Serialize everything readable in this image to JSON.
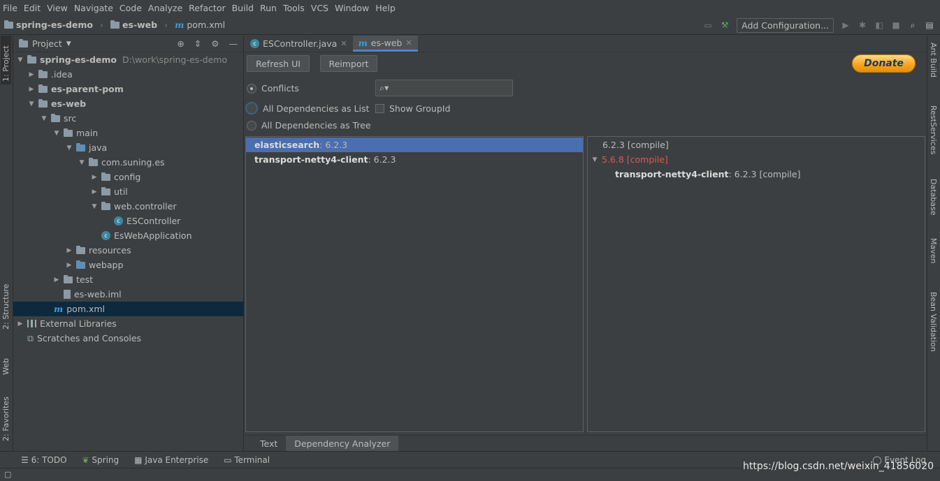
{
  "menu": [
    "File",
    "Edit",
    "View",
    "Navigate",
    "Code",
    "Analyze",
    "Refactor",
    "Build",
    "Run",
    "Tools",
    "VCS",
    "Window",
    "Help"
  ],
  "breadcrumb": {
    "project": "spring-es-demo",
    "module": "es-web",
    "file": "pom.xml"
  },
  "toolbar": {
    "add_config": "Add Configuration..."
  },
  "left_stripe": {
    "project": "1: Project",
    "structure": "2: Structure",
    "web": "Web",
    "favorites": "2: Favorites"
  },
  "right_stripe": {
    "ant": "Ant Build",
    "rest": "RestServices",
    "db": "Database",
    "maven": "Maven",
    "bean": "Bean Validation"
  },
  "project_panel": {
    "title": "Project",
    "root_path": "D:\\work\\spring-es-demo",
    "items": [
      {
        "label": "spring-es-demo",
        "bold": true
      },
      {
        "label": ".idea"
      },
      {
        "label": "es-parent-pom",
        "bold": true
      },
      {
        "label": "es-web",
        "bold": true
      },
      {
        "label": "src"
      },
      {
        "label": "main"
      },
      {
        "label": "java"
      },
      {
        "label": "com.suning.es"
      },
      {
        "label": "config"
      },
      {
        "label": "util"
      },
      {
        "label": "web.controller"
      },
      {
        "label": "ESController"
      },
      {
        "label": "EsWebApplication"
      },
      {
        "label": "resources"
      },
      {
        "label": "webapp"
      },
      {
        "label": "test"
      },
      {
        "label": "es-web.iml"
      },
      {
        "label": "pom.xml"
      },
      {
        "label": "External Libraries"
      },
      {
        "label": "Scratches and Consoles"
      }
    ]
  },
  "editor_tabs": [
    {
      "label": "ESController.java"
    },
    {
      "label": "es-web"
    }
  ],
  "analyzer": {
    "refresh": "Refresh UI",
    "reimport": "Reimport",
    "donate": "Donate",
    "conflicts": "Conflicts",
    "all_list": "All Dependencies as List",
    "all_tree": "All Dependencies as Tree",
    "show_group": "Show GroupId",
    "left_rows": [
      {
        "name": "elasticsearch",
        "ver": " : 6.2.3"
      },
      {
        "name": "transport-netty4-client",
        "ver": " : 6.2.3"
      }
    ],
    "right_rows": {
      "r1": "6.2.3 [compile]",
      "r2": "5.6.8 [compile]",
      "r3_name": "transport-netty4-client",
      "r3_ver": " : 6.2.3 [compile]"
    },
    "bottom_tabs": [
      "Text",
      "Dependency Analyzer"
    ]
  },
  "tool_windows": [
    "6: TODO",
    "Spring",
    "Java Enterprise",
    "Terminal"
  ],
  "event_log": "Event Log",
  "watermark": "https://blog.csdn.net/weixin_41856020"
}
